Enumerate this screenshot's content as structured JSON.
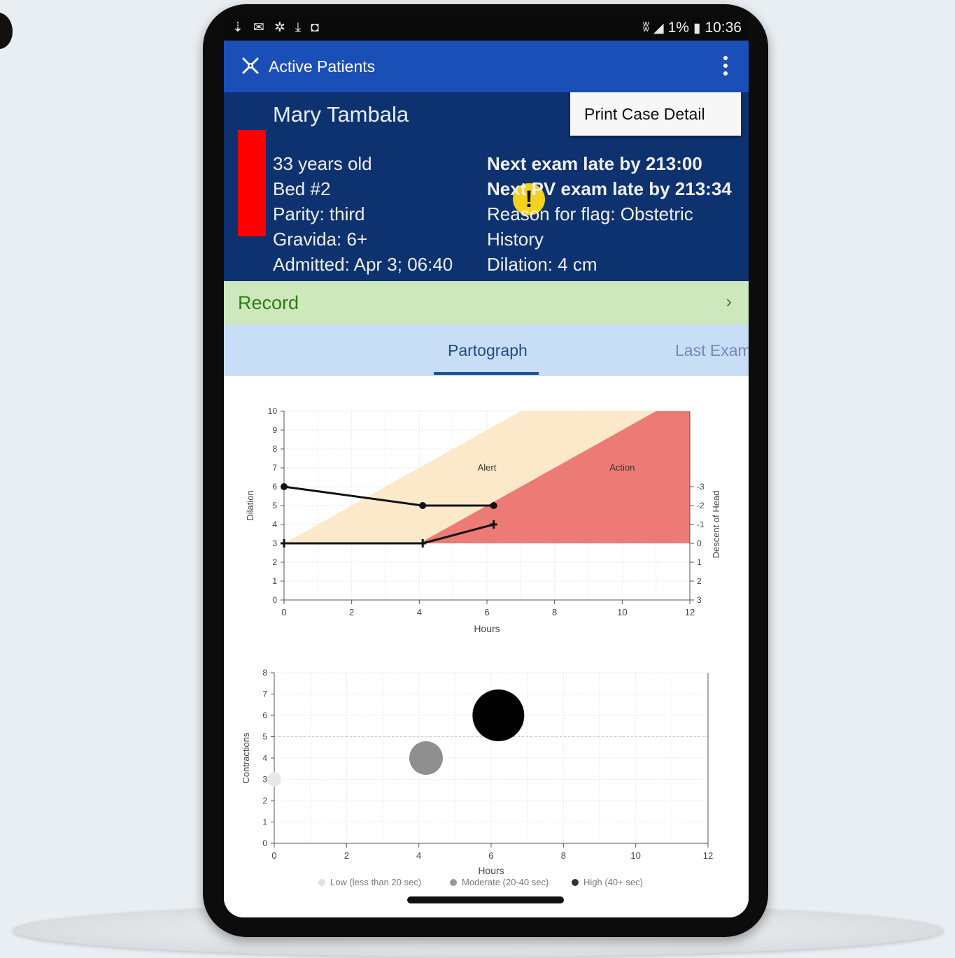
{
  "status_bar": {
    "left_icons": [
      "usb-icon",
      "mail-icon",
      "app-logo-icon",
      "download-icon",
      "camera-icon"
    ],
    "battery": "1%",
    "time": "10:36"
  },
  "app_bar": {
    "title": "Active Patients"
  },
  "patient": {
    "name": "Mary Tambala",
    "age": "33 years old",
    "bed": "Bed #2",
    "parity": "Parity: third",
    "gravida": "Gravida: 6+",
    "admitted": "Admitted: Apr 3; 06:40",
    "next_exam": "Next exam late by 213:00",
    "next_pv_exam": "Next PV exam late by 213:34",
    "flag_reason": "Reason for flag: Obstetric History",
    "dilation": "Dilation: 4 cm",
    "flag_color": "#ff0000",
    "warning_symbol": "!"
  },
  "popup_menu": {
    "item": "Print Case Detail"
  },
  "record_bar": {
    "label": "Record",
    "chevron": "›"
  },
  "tabs": [
    {
      "label": "Partograph",
      "active": true
    },
    {
      "label": "Last Exam",
      "active": false
    }
  ],
  "chart_data": [
    {
      "type": "line",
      "xlabel": "Hours",
      "ylabel": "Dilation",
      "y2label": "Descent of Head",
      "xlim": [
        0,
        12
      ],
      "ylim": [
        0,
        10
      ],
      "x_ticks": [
        0,
        2,
        4,
        6,
        8,
        10,
        12
      ],
      "y_ticks": [
        0,
        1,
        2,
        3,
        4,
        5,
        6,
        7,
        8,
        9,
        10
      ],
      "y2_ticks": [
        "-3",
        "-2",
        "-1",
        "0",
        "1",
        "2",
        "3"
      ],
      "zones": [
        {
          "label": "Alert",
          "color": "#fbe9c9"
        },
        {
          "label": "Action",
          "color": "#ec7b76"
        }
      ],
      "series": [
        {
          "points": [
            [
              0,
              6
            ],
            [
              4.1,
              5
            ],
            [
              6.2,
              5
            ]
          ]
        },
        {
          "points": [
            [
              0,
              3
            ],
            [
              4.1,
              3
            ],
            [
              6.2,
              4
            ]
          ]
        }
      ]
    },
    {
      "type": "scatter",
      "xlabel": "Hours",
      "ylabel": "Contractions",
      "xlim": [
        0,
        12
      ],
      "ylim": [
        0,
        8
      ],
      "x_ticks": [
        0,
        2,
        4,
        6,
        8,
        10,
        12
      ],
      "y_ticks": [
        0,
        1,
        2,
        3,
        4,
        5,
        6,
        7,
        8
      ],
      "points": [
        {
          "x": 0.0,
          "y": 3,
          "category": "low",
          "color": "#e8e8e8"
        },
        {
          "x": 4.2,
          "y": 4,
          "category": "moderate",
          "color": "#8f8f8f"
        },
        {
          "x": 6.2,
          "y": 6,
          "category": "high",
          "color": "#000000"
        }
      ],
      "legend": [
        {
          "label": "Low (less than 20 sec)",
          "color": "#e0e0e0"
        },
        {
          "label": "Moderate (20-40 sec)",
          "color": "#9a9a9a"
        },
        {
          "label": "High (40+ sec)",
          "color": "#333333"
        }
      ]
    }
  ]
}
